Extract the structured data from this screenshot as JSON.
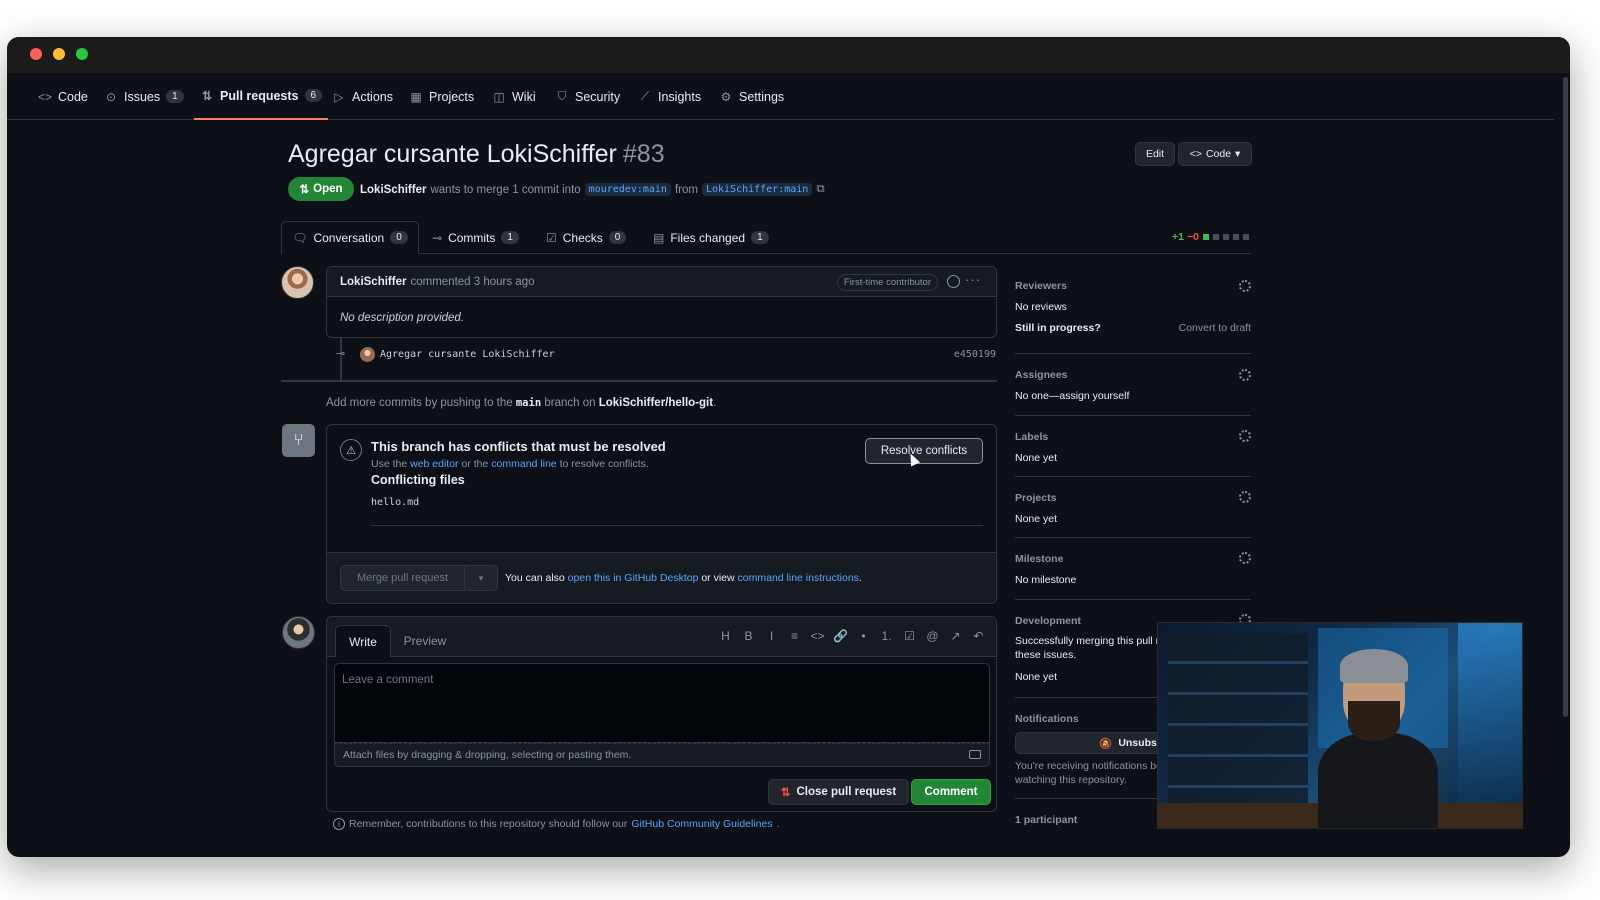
{
  "repo_nav": {
    "items": [
      {
        "label": "Code",
        "icon": "code-icon"
      },
      {
        "label": "Issues",
        "count": "1",
        "icon": "issue-icon"
      },
      {
        "label": "Pull requests",
        "count": "6",
        "icon": "pull-request-icon",
        "active": true
      },
      {
        "label": "Actions",
        "icon": "play-icon"
      },
      {
        "label": "Projects",
        "icon": "table-icon"
      },
      {
        "label": "Wiki",
        "icon": "book-icon"
      },
      {
        "label": "Security",
        "icon": "shield-icon"
      },
      {
        "label": "Insights",
        "icon": "graph-icon"
      },
      {
        "label": "Settings",
        "icon": "gear-icon"
      }
    ]
  },
  "pr": {
    "title": "Agregar cursante LokiSchiffer",
    "number": "#83",
    "state": "Open",
    "author": "LokiSchiffer",
    "merge_text": "wants to merge 1 commit into",
    "base_branch": "mouredev:main",
    "from_text": "from",
    "head_branch": "LokiSchiffer:main",
    "edit_label": "Edit",
    "code_label": "Code"
  },
  "tabs": [
    {
      "label": "Conversation",
      "count": "0",
      "icon": "comment-discussion-icon"
    },
    {
      "label": "Commits",
      "count": "1",
      "icon": "commit-icon"
    },
    {
      "label": "Checks",
      "count": "0",
      "icon": "checklist-icon"
    },
    {
      "label": "Files changed",
      "count": "1",
      "icon": "file-diff-icon"
    }
  ],
  "diffstat": {
    "additions": "+1",
    "deletions": "−0",
    "blocks": [
      "green",
      "gray",
      "gray",
      "gray",
      "gray"
    ]
  },
  "comment": {
    "author": "LokiSchiffer",
    "action": "commented 3 hours ago",
    "badge": "First-time contributor",
    "body": "No description provided."
  },
  "commit": {
    "message": "Agregar cursante LokiSchiffer",
    "sha": "e450199"
  },
  "push_hint": {
    "prefix": "Add more commits by pushing to the",
    "branch": "main",
    "middle": "branch on",
    "repo": "LokiSchiffer/hello-git",
    "suffix": "."
  },
  "conflict": {
    "title": "This branch has conflicts that must be resolved",
    "desc_prefix": "Use the",
    "web_editor": "web editor",
    "desc_middle": "or the",
    "command_line": "command line",
    "desc_suffix": "to resolve conflicts.",
    "files_title": "Conflicting files",
    "file": "hello.md",
    "resolve_label": "Resolve conflicts"
  },
  "merge": {
    "button_label": "Merge pull request",
    "alt_prefix": "You can also",
    "alt_link1": "open this in GitHub Desktop",
    "alt_middle": "or view",
    "alt_link2": "command line instructions",
    "alt_suffix": "."
  },
  "editor": {
    "write_label": "Write",
    "preview_label": "Preview",
    "placeholder": "Leave a comment",
    "attach_text": "Attach files by dragging & dropping, selecting or pasting them.",
    "toolbar": [
      "H",
      "B",
      "I",
      "≡",
      "<>",
      "🔗",
      "•",
      "1.",
      "☑",
      "@",
      "↗",
      "↶"
    ],
    "close_label": "Close pull request",
    "comment_label": "Comment"
  },
  "guidelines": {
    "prefix": "Remember, contributions to this repository should follow our",
    "link": "GitHub Community Guidelines",
    "suffix": "."
  },
  "sidebar": {
    "reviewers": {
      "heading": "Reviewers",
      "value": "No reviews",
      "in_progress": "Still in progress?",
      "convert": "Convert to draft"
    },
    "assignees": {
      "heading": "Assignees",
      "value": "No one—assign yourself"
    },
    "labels": {
      "heading": "Labels",
      "value": "None yet"
    },
    "projects": {
      "heading": "Projects",
      "value": "None yet"
    },
    "milestone": {
      "heading": "Milestone",
      "value": "No milestone"
    },
    "development": {
      "heading": "Development",
      "line1": "Successfully merging this pull r",
      "line2": "these issues.",
      "value": "None yet"
    },
    "notifications": {
      "heading": "Notifications",
      "button": "Unsubscr",
      "line1": "You're receiving notifications be",
      "line2": "watching this repository."
    },
    "participants": {
      "heading": "1 participant"
    }
  },
  "colors": {
    "accent_green": "#238636",
    "link_blue": "#58a6ff",
    "active_tab": "#f78166",
    "danger": "#f85149"
  }
}
